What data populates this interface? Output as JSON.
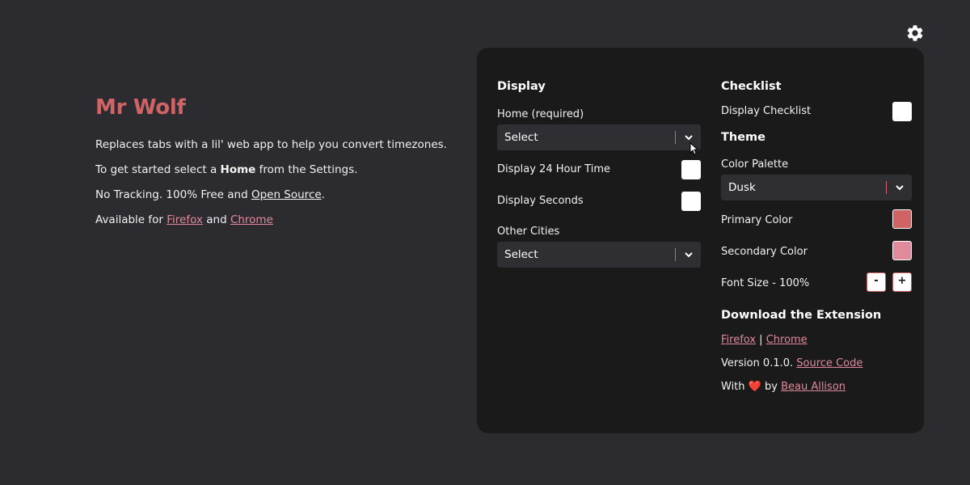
{
  "intro": {
    "title": "Mr Wolf",
    "line1": "Replaces tabs with a lil' web app to help you convert timezones.",
    "line2_pre": "To get started select a ",
    "line2_bold": "Home",
    "line2_post": " from the Settings.",
    "line3_pre": "No Tracking. 100% Free and ",
    "line3_link": "Open Source",
    "line3_post": ".",
    "line4_pre": "Available for ",
    "line4_link1": "Firefox",
    "line4_mid": " and ",
    "line4_link2": "Chrome"
  },
  "settings": {
    "display": {
      "title": "Display",
      "home_label": "Home (required)",
      "home_select": "Select",
      "hour24_label": "Display 24 Hour Time",
      "seconds_label": "Display Seconds",
      "other_cities_label": "Other Cities",
      "other_cities_select": "Select"
    },
    "checklist": {
      "title": "Checklist",
      "display_label": "Display Checklist"
    },
    "theme": {
      "title": "Theme",
      "palette_label": "Color Palette",
      "palette_value": "Dusk",
      "primary_label": "Primary Color",
      "secondary_label": "Secondary Color",
      "font_size_label": "Font Size - 100%",
      "decrease": "-",
      "increase": "+"
    },
    "download": {
      "title": "Download the Extension",
      "firefox": "Firefox",
      "separator": " | ",
      "chrome": "Chrome",
      "version_pre": "Version 0.1.0. ",
      "source_code": "Source Code",
      "with_pre": "With ",
      "heart": "❤️",
      "with_mid": " by ",
      "author": "Beau Allison"
    }
  },
  "colors": {
    "background": "#2c2b30",
    "panel": "#1a1a1a",
    "primary": "#d06464",
    "secondary": "#e08a9c"
  },
  "icons": {
    "settings": "gear-icon",
    "dropdown": "chevron-down-icon",
    "pointer": "mouse-cursor-icon"
  }
}
